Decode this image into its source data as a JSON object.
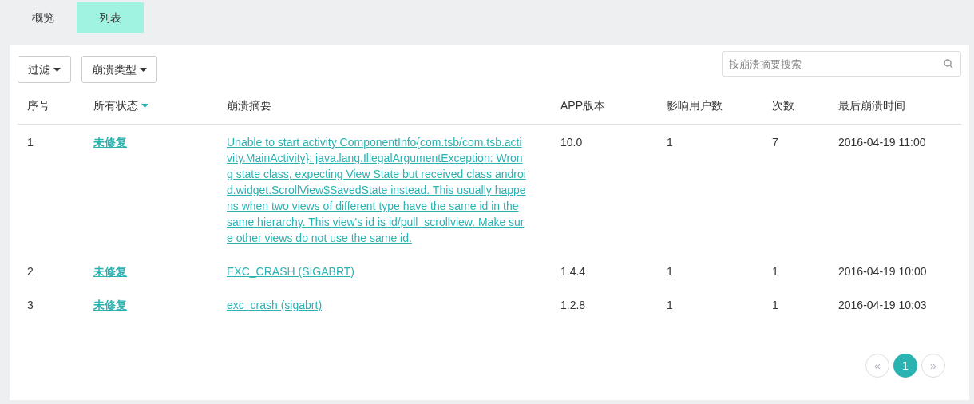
{
  "tabs": [
    {
      "label": "概览",
      "selected": false
    },
    {
      "label": "列表",
      "selected": true
    }
  ],
  "filters": [
    {
      "label": "过滤"
    },
    {
      "label": "崩溃类型"
    }
  ],
  "search": {
    "placeholder": "按崩溃摘要搜索"
  },
  "table": {
    "columns": [
      "序号",
      "所有状态",
      "崩溃摘要",
      "APP版本",
      "影响用户数",
      "次数",
      "最后崩溃时间"
    ],
    "rows": [
      {
        "index": "1",
        "status": "未修复",
        "summary": "Unable to start activity ComponentInfo{com.tsb/com.tsb.activity.MainActivity}: java.lang.IllegalArgumentException: Wrong state class, expecting View State but received class android.widget.ScrollView$SavedState instead. This usually happens when two views of different type have the same id in the same hierarchy. This view's id is id/pull_scrollview. Make sure other views do not use the same id.",
        "version": "10.0",
        "users": "1",
        "count": "7",
        "last_time": "2016-04-19 11:00"
      },
      {
        "index": "2",
        "status": "未修复",
        "summary": "EXC_CRASH (SIGABRT)",
        "version": "1.4.4",
        "users": "1",
        "count": "1",
        "last_time": "2016-04-19 10:00"
      },
      {
        "index": "3",
        "status": "未修复",
        "summary": "exc_crash (sigabrt)",
        "version": "1.2.8",
        "users": "1",
        "count": "1",
        "last_time": "2016-04-19 10:03"
      }
    ]
  },
  "pagination": [
    {
      "label": "«",
      "selected": false
    },
    {
      "label": "1",
      "selected": true
    },
    {
      "label": "»",
      "selected": false
    }
  ]
}
